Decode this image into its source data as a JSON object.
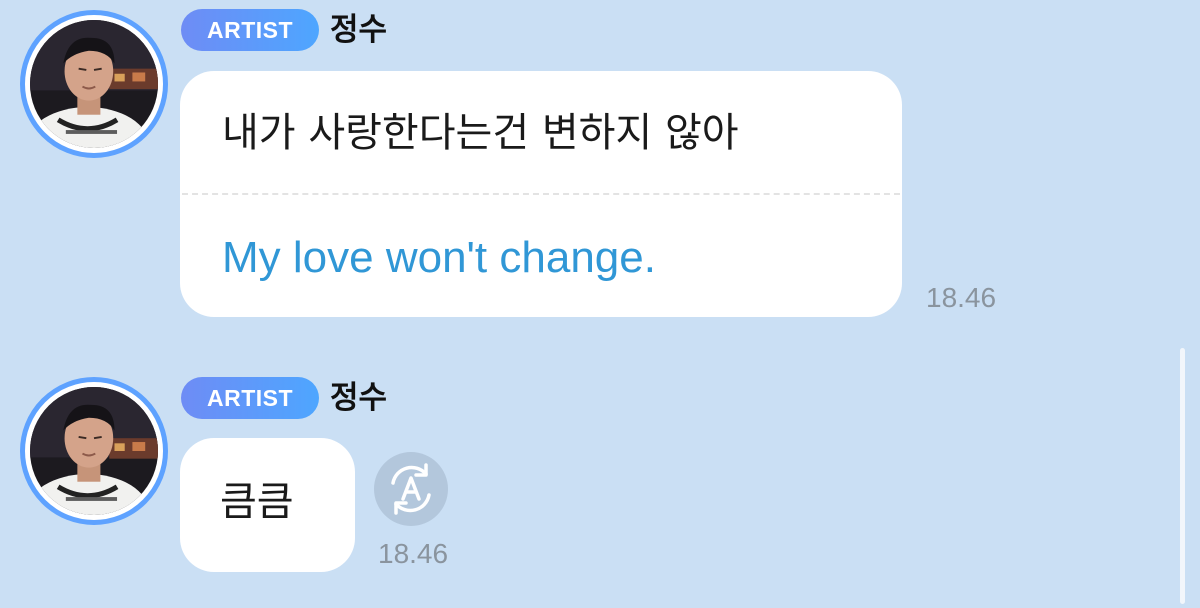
{
  "conversation": {
    "messages": [
      {
        "badge": "ARTIST",
        "sender": "정수",
        "text": "내가 사랑한다는건 변하지 않아",
        "translation": "My love won't change.",
        "time": "18.46",
        "avatar_icon": "artist-profile-photo"
      },
      {
        "badge": "ARTIST",
        "sender": "정수",
        "text": "큼큼",
        "time": "18.46",
        "avatar_icon": "artist-profile-photo",
        "translate_icon": "translate-icon"
      }
    ]
  },
  "colors": {
    "background": "#cadff4",
    "badge_gradient_start": "#6e8cf5",
    "badge_gradient_end": "#4ea6ff",
    "avatar_ring": "#5ea2ff",
    "translation_text": "#3097d6",
    "timestamp": "#8a949e",
    "bubble": "#ffffff"
  }
}
